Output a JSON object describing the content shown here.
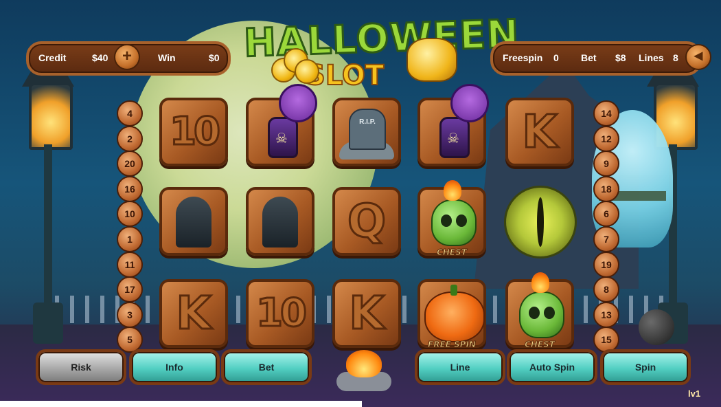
{
  "title": {
    "line1": "HALLOWEEN",
    "line2": "SLOT"
  },
  "left_panel": {
    "credit_label": "Credit",
    "credit_value": "$40",
    "plus_label": "+",
    "win_label": "Win",
    "win_value": "$0"
  },
  "right_panel": {
    "freespin_label": "Freespin",
    "freespin_value": "0",
    "bet_label": "Bet",
    "bet_value": "$8",
    "lines_label": "Lines",
    "lines_value": "8",
    "sound_icon": "speaker-icon"
  },
  "reels": [
    [
      {
        "symbol": "10",
        "type": "letter"
      },
      {
        "symbol": "reaper",
        "type": "icon"
      },
      {
        "symbol": "K",
        "type": "letter"
      }
    ],
    [
      {
        "symbol": "potion",
        "type": "icon"
      },
      {
        "symbol": "reaper",
        "type": "icon"
      },
      {
        "symbol": "10",
        "type": "letter"
      }
    ],
    [
      {
        "symbol": "tombstone",
        "type": "icon",
        "text": "R.I.P."
      },
      {
        "symbol": "Q",
        "type": "letter"
      },
      {
        "symbol": "K",
        "type": "letter"
      }
    ],
    [
      {
        "symbol": "potion",
        "type": "icon"
      },
      {
        "symbol": "chest-skull",
        "type": "icon",
        "caption": "CHEST"
      },
      {
        "symbol": "pumpkin",
        "type": "icon",
        "caption": "FREE SPIN"
      }
    ],
    [
      {
        "symbol": "K",
        "type": "letter"
      },
      {
        "symbol": "eye",
        "type": "icon"
      },
      {
        "symbol": "chest-skull",
        "type": "icon",
        "caption": "CHEST"
      }
    ]
  ],
  "left_lines": [
    "4",
    "2",
    "20",
    "16",
    "10",
    "1",
    "11",
    "17",
    "3",
    "5"
  ],
  "right_lines": [
    "14",
    "12",
    "9",
    "18",
    "6",
    "7",
    "19",
    "8",
    "13",
    "15"
  ],
  "buttons": {
    "risk": "Risk",
    "info": "Info",
    "bet": "Bet",
    "line": "Line",
    "auto_spin": "Auto Spin",
    "spin": "Spin"
  },
  "version": "lv1",
  "colors": {
    "panel_bg": "#6b3313",
    "button_teal": "#52cfc2",
    "button_gray": "#a8a8a8",
    "title_green": "#9bd83a",
    "title_gold": "#f6c21e"
  }
}
